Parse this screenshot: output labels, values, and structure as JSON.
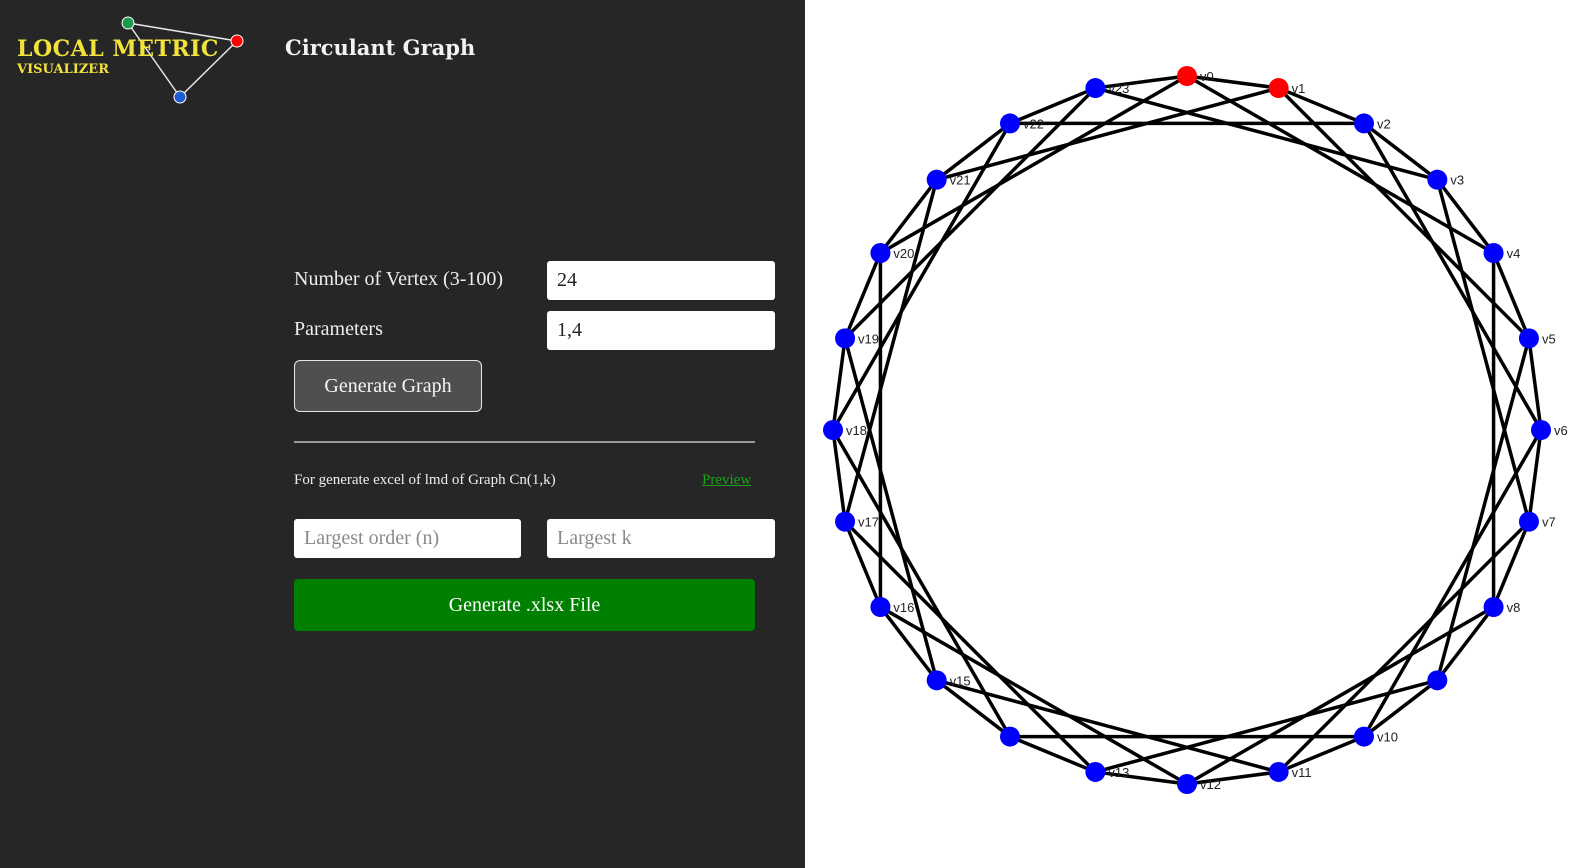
{
  "logo": {
    "title": "LOCAL METRIC",
    "subtitle": "VISUALIZER",
    "title_color": "#f2e23c",
    "node_colors": [
      "#1a9a4a",
      "#ff0000",
      "#1f5bd1"
    ]
  },
  "header": {
    "title": "Circulant Graph"
  },
  "form": {
    "vertex_label": "Number of Vertex (3-100)",
    "vertex_value": "24",
    "params_label": "Parameters",
    "params_value": "1,4",
    "generate_graph_label": "Generate Graph"
  },
  "excel": {
    "description": "For generate excel of lmd of Graph Cn(1,k)",
    "preview_label": "Preview",
    "largest_order_placeholder": "Largest order (n)",
    "largest_k_placeholder": "Largest k",
    "generate_xlsx_label": "Generate .xlsx File"
  },
  "graph": {
    "vertex_count": 24,
    "parameters": [
      1,
      4
    ],
    "red_vertices": [
      0,
      1
    ],
    "node_color": "#0000ff",
    "highlight_color": "#ff0000",
    "edge_color": "#000000",
    "labels": [
      "v0",
      "v1",
      "v2",
      "v3",
      "v4",
      "v5",
      "v6",
      "v7",
      "v8",
      "",
      "v10",
      "v11",
      "v12",
      "v13",
      "",
      "v15",
      "v16",
      "v17",
      "v18",
      "v19",
      "v20",
      "v21",
      "v22",
      "v23"
    ]
  }
}
